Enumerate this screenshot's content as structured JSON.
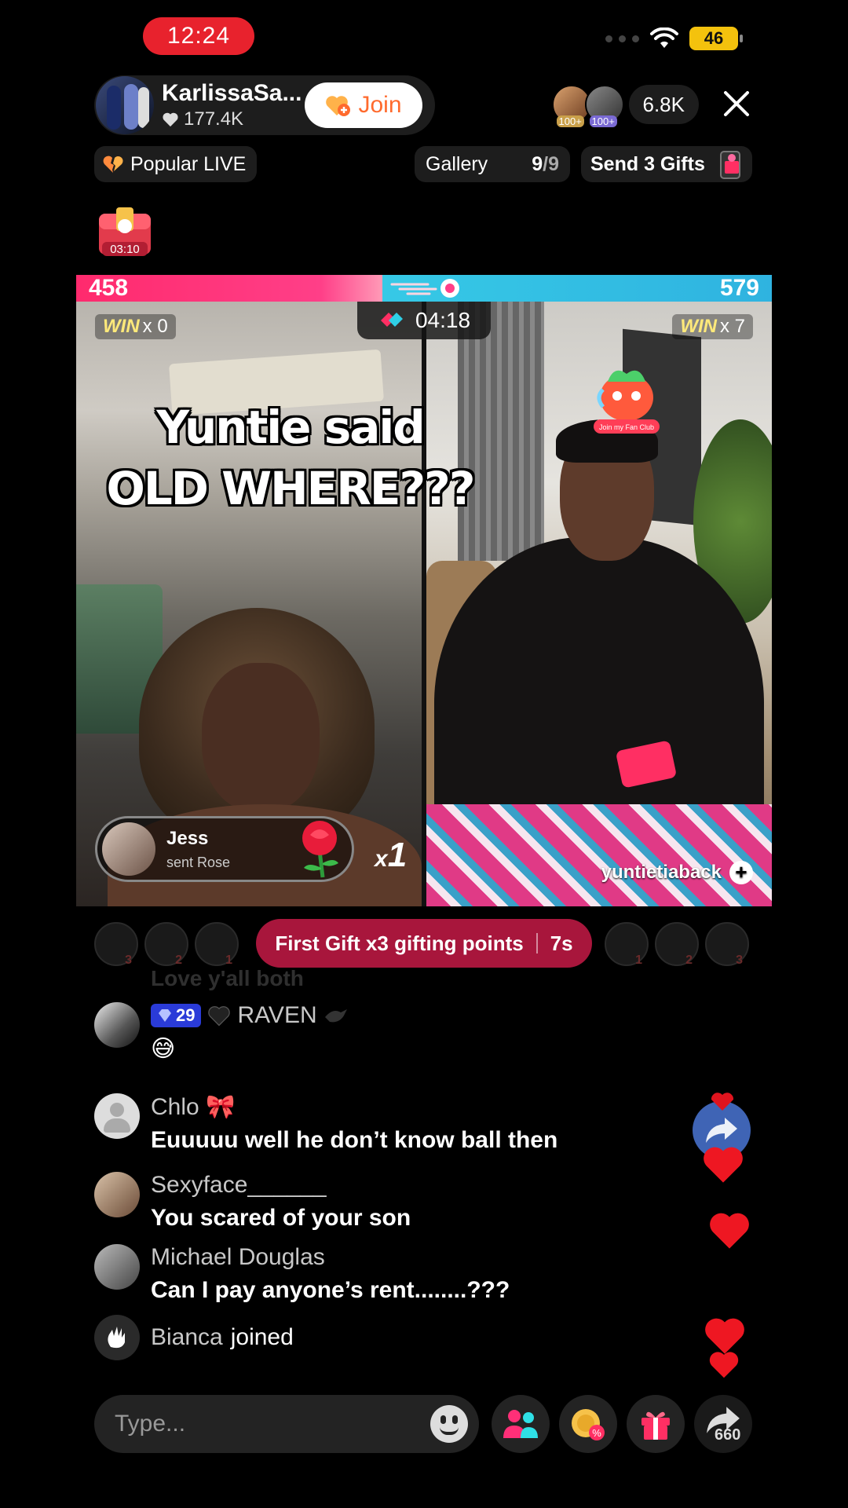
{
  "status_bar": {
    "time": "12:24",
    "signal": "4G",
    "battery": "46"
  },
  "host": {
    "name": "KarlissaSa...",
    "likes": "177.4K",
    "join_label": "Join"
  },
  "viewers": {
    "badge1": "100+",
    "badge2": "100+",
    "count": "6.8K"
  },
  "chips": {
    "popular_label": "Popular LIVE",
    "gallery_label": "Gallery",
    "gallery_count": "9",
    "gallery_total": "/9",
    "gifts_label": "Send 3 Gifts"
  },
  "treasure_timer": "03:10",
  "battle": {
    "left_score": "458",
    "right_score": "579",
    "timer": "04:18",
    "left_wins_label": "WIN",
    "left_wins": "x 0",
    "right_wins_label": "WIN",
    "right_wins": "x 7",
    "caption_line1": "Yuntie said",
    "caption_line2": "OLD WHERE???",
    "gift_toast": {
      "user": "Jess",
      "action": "sent Rose",
      "count_prefix": "x",
      "count": "1"
    },
    "right_handle": "yuntietiaback",
    "fan_club_text": "Join my Fan Club"
  },
  "gifting": {
    "label": "First Gift x3 gifting points",
    "countdown": "7s",
    "left_ranks": [
      "3",
      "2",
      "1"
    ],
    "right_ranks": [
      "1",
      "2",
      "3"
    ]
  },
  "comments": {
    "faded_text": "Love y'all both",
    "items": [
      {
        "user": "RAVEN",
        "level": "29",
        "text": "😅"
      },
      {
        "user": "Chlo 🎀",
        "text": "Euuuuu well he don’t know ball then"
      },
      {
        "user": "Sexyface______",
        "text": "You scared of your son"
      },
      {
        "user": "Michael Douglas",
        "text": "Can I pay anyone’s rent........???"
      }
    ],
    "joined": {
      "user": "Bianca",
      "text": "joined"
    }
  },
  "bottom_bar": {
    "placeholder": "Type...",
    "share_count": "660"
  },
  "colors": {
    "live_red": "#e8222d",
    "left_team": "#ff2a6d",
    "right_team": "#36c9e6",
    "gift_banner": "#a8163c",
    "join_orange": "#ff6a2d"
  }
}
